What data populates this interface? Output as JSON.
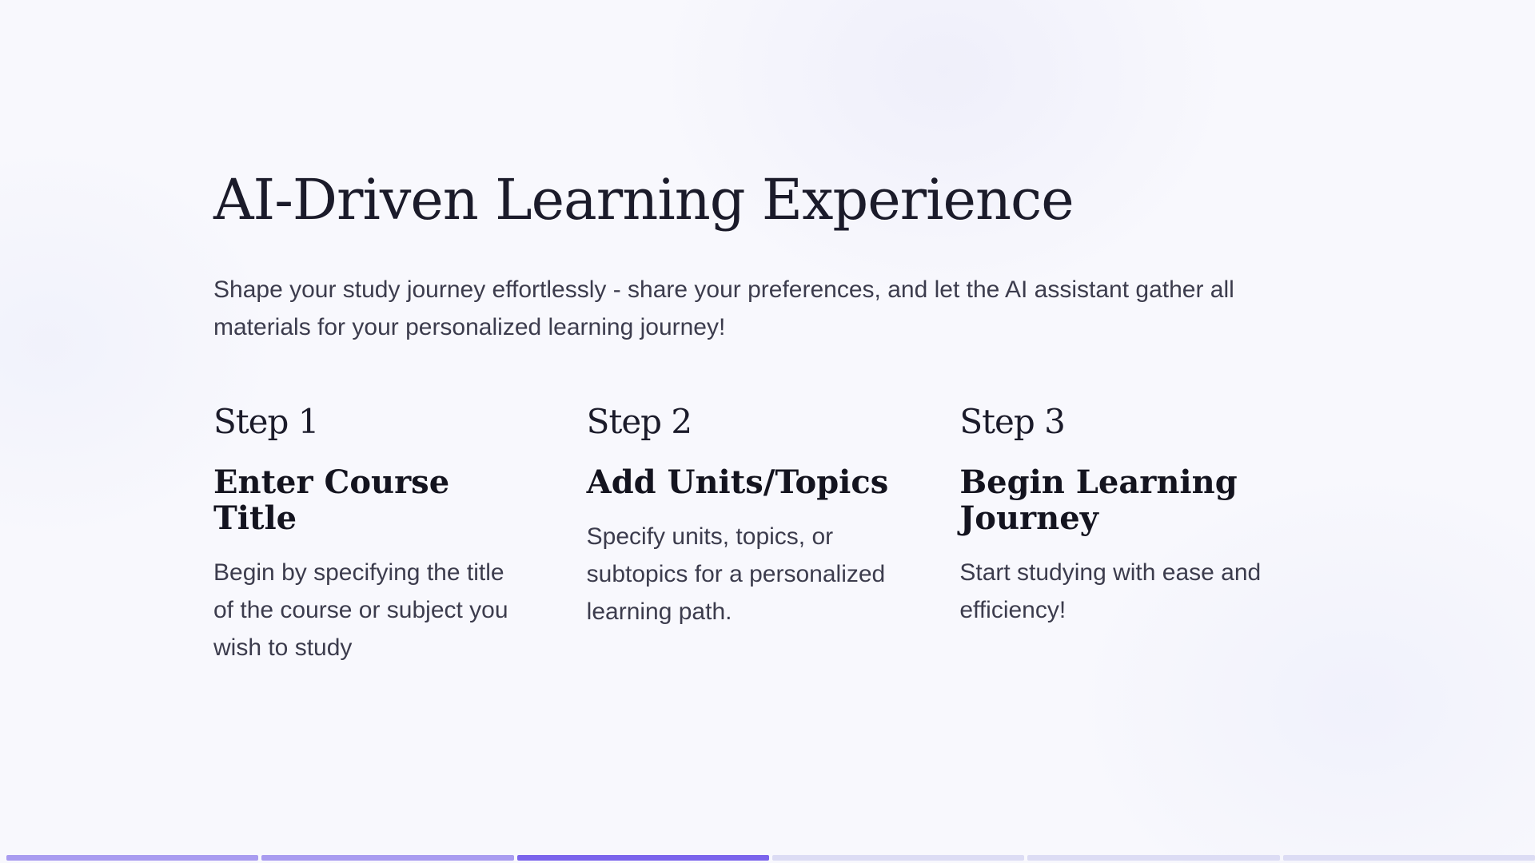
{
  "slide": {
    "title": "AI-Driven Learning Experience",
    "intro": "Shape your study journey effortlessly - share your preferences, and let the AI assistant gather all materials for your personalized learning journey!"
  },
  "steps": [
    {
      "number": "Step 1",
      "heading": "Enter Course Title",
      "text": "Begin by specifying the title of the course or subject you wish to study"
    },
    {
      "number": "Step 2",
      "heading": "Add Units/Topics",
      "text": "Specify units, topics, or subtopics for a personalized learning path."
    },
    {
      "number": "Step 3",
      "heading": "Begin Learning Journey",
      "text": "Start studying with ease and efficiency!"
    }
  ],
  "progress": {
    "total_slides": 6,
    "current_slide": 3
  },
  "colors": {
    "background": "#f8f8fd",
    "accent": "#7b64ec",
    "accent_light": "#a99cf0",
    "track": "#dcdcf4"
  }
}
